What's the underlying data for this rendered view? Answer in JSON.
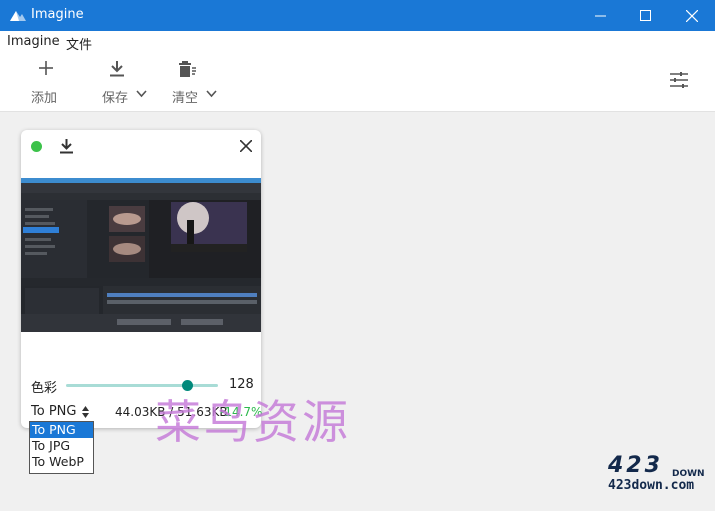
{
  "window": {
    "title": "Imagine"
  },
  "menu": {
    "items": [
      "Imagine",
      "文件"
    ]
  },
  "toolbar": {
    "add_label": "添加",
    "save_label": "保存",
    "clear_label": "清空"
  },
  "card": {
    "slider_label": "色彩",
    "slider_value": "128",
    "slider_fraction": 0.8,
    "format_label": "To PNG",
    "size_text": "44.03KB / 51.63KB",
    "delta_text": "-14.7%"
  },
  "dropdown": {
    "options": [
      "To PNG",
      "To JPG",
      "To WebP"
    ],
    "selected": "To PNG"
  },
  "watermark": {
    "text": "菜鸟资源"
  },
  "logo": {
    "number": "423",
    "subtitle": "DOWN",
    "url": "423down.com"
  },
  "colors": {
    "titlebar": "#1a78d6",
    "status": "#3cc24a",
    "accent": "#00897b",
    "delta": "#2db84d"
  },
  "icons": {
    "add": "plus-icon",
    "save": "download-icon",
    "clear": "trash-icon",
    "settings": "sliders-icon"
  }
}
